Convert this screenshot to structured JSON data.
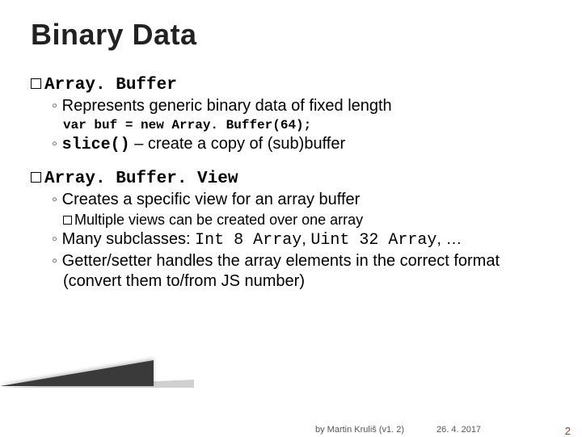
{
  "title": "Binary Data",
  "section1": {
    "heading": "Array. Buffer",
    "b1": "Represents generic binary data of fixed length",
    "code": "var buf = new Array. Buffer(64);",
    "b2_code": "slice()",
    "b2_rest": " – create a copy of (sub)buffer"
  },
  "section2": {
    "heading": "Array. Buffer. View",
    "b1": "Creates a specific view for an array buffer",
    "b1_sub": "Multiple views can be created over one array",
    "b2_pre": "Many subclasses: ",
    "b2_c1": "Int 8 Array",
    "b2_mid": ", ",
    "b2_c2": "Uint 32 Array",
    "b2_post": ", …",
    "b3": "Getter/setter handles the array elements in the correct format (convert them to/from JS number)"
  },
  "footer": {
    "author": "by Martin Kruliš (v1. 2)",
    "date": "26. 4. 2017",
    "page": "2"
  }
}
